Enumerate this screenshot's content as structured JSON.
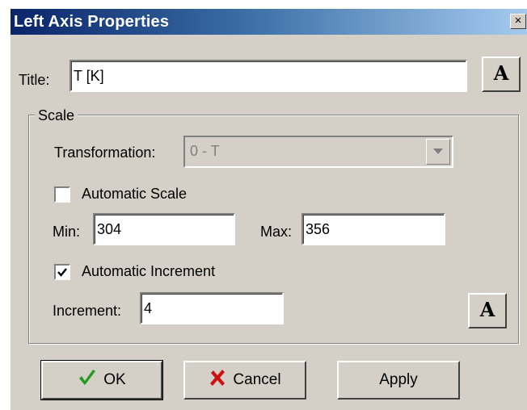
{
  "window": {
    "title": "Left Axis Properties",
    "close_glyph": "×"
  },
  "title_field": {
    "label": "Title:",
    "value": "T [K]",
    "font_button_label": "A"
  },
  "scale": {
    "legend": "Scale",
    "transformation": {
      "label": "Transformation:",
      "selected": "0 - T",
      "enabled": false
    },
    "automatic_scale": {
      "label": "Automatic Scale",
      "checked": false
    },
    "min": {
      "label": "Min:",
      "value": "304"
    },
    "max": {
      "label": "Max:",
      "value": "356"
    },
    "automatic_increment": {
      "label": "Automatic Increment",
      "checked": true
    },
    "increment": {
      "label": "Increment:",
      "value": "4"
    },
    "font_button_label": "A"
  },
  "buttons": {
    "ok": {
      "label": "OK",
      "icon": "green-check-icon"
    },
    "cancel": {
      "label": "Cancel",
      "icon": "red-x-icon"
    },
    "apply": {
      "label": "Apply"
    }
  },
  "colors": {
    "titlebar_start": "#0a246a",
    "titlebar_end": "#a6caf0",
    "face": "#d4d0c8",
    "ok_check": "#1f9d1f",
    "cancel_x": "#cc1010"
  }
}
